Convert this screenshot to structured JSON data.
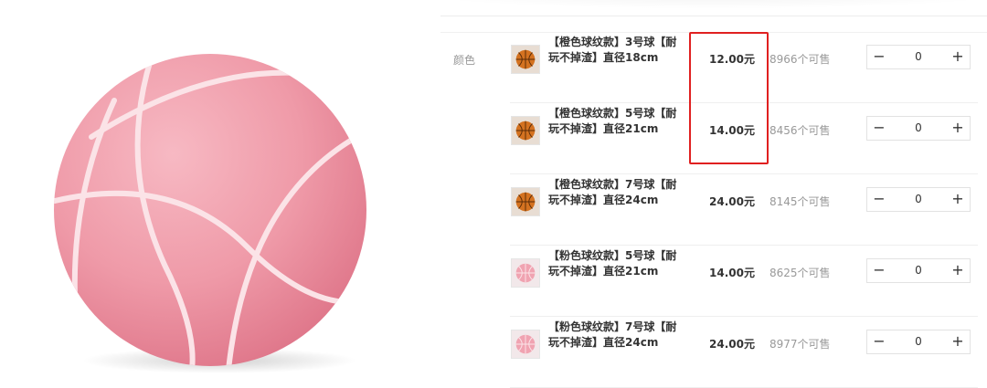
{
  "option": {
    "label": "颜色"
  },
  "skus": [
    {
      "name": "【橙色球纹款】3号球【耐玩不掉渣】直径18cm",
      "price": "12.00元",
      "stock": "8966个可售",
      "qty": "0",
      "thumb": "orange-basketball"
    },
    {
      "name": "【橙色球纹款】5号球【耐玩不掉渣】直径21cm",
      "price": "14.00元",
      "stock": "8456个可售",
      "qty": "0",
      "thumb": "orange-basketball"
    },
    {
      "name": "【橙色球纹款】7号球【耐玩不掉渣】直径24cm",
      "price": "24.00元",
      "stock": "8145个可售",
      "qty": "0",
      "thumb": "orange-basketball"
    },
    {
      "name": "【粉色球纹款】5号球【耐玩不掉渣】直径21cm",
      "price": "14.00元",
      "stock": "8625个可售",
      "qty": "0",
      "thumb": "pink-basketball"
    },
    {
      "name": "【粉色球纹款】7号球【耐玩不掉渣】直径24cm",
      "price": "24.00元",
      "stock": "8977个可售",
      "qty": "0",
      "thumb": "pink-basketball"
    }
  ],
  "stepper": {
    "minus": "−",
    "plus": "+"
  },
  "colors": {
    "highlight": "#e02020",
    "ball_pink": "#f0a0ad",
    "ball_orange": "#d9731f"
  }
}
